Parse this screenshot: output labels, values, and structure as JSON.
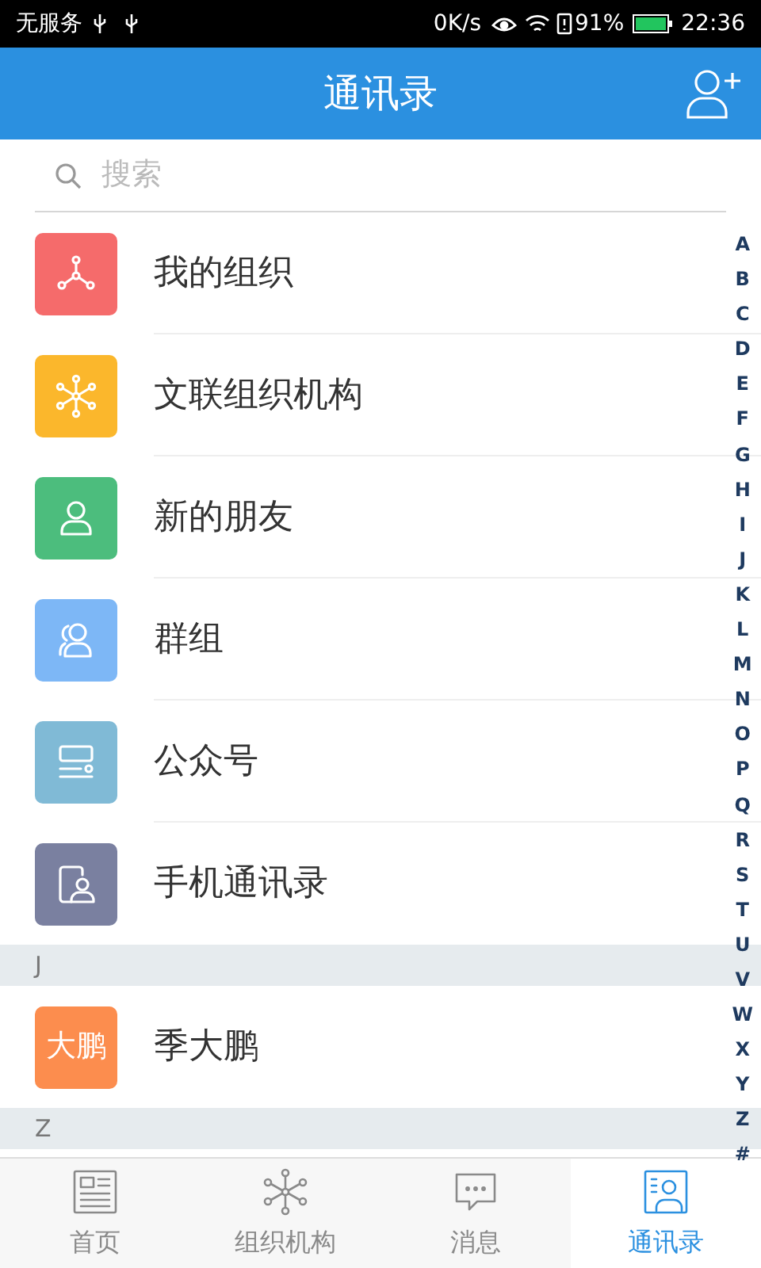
{
  "status_bar": {
    "carrier": "无服务",
    "speed": "0K/s",
    "battery": "91%",
    "time": "22:36"
  },
  "header": {
    "title": "通讯录"
  },
  "search": {
    "placeholder": "搜索"
  },
  "sections": [
    {
      "items": [
        {
          "kind": "icon",
          "label": "我的组织",
          "color": "#f56b6b"
        },
        {
          "kind": "icon",
          "label": "文联组织机构",
          "color": "#fbb72c"
        },
        {
          "kind": "icon",
          "label": "新的朋友",
          "color": "#4cbd7d"
        },
        {
          "kind": "icon",
          "label": "群组",
          "color": "#7db7f6"
        },
        {
          "kind": "icon",
          "label": "公众号",
          "color": "#80bad6"
        },
        {
          "kind": "icon",
          "label": "手机通讯录",
          "color": "#7a80a0"
        }
      ]
    },
    {
      "letter": "J",
      "items": [
        {
          "kind": "avatar",
          "avatar": "大鹏",
          "label": "季大鹏",
          "color": "#fc8d4e"
        }
      ]
    },
    {
      "letter": "Z"
    }
  ],
  "index": [
    "A",
    "B",
    "C",
    "D",
    "E",
    "F",
    "G",
    "H",
    "I",
    "J",
    "K",
    "L",
    "M",
    "N",
    "O",
    "P",
    "Q",
    "R",
    "S",
    "T",
    "U",
    "V",
    "W",
    "X",
    "Y",
    "Z",
    "#"
  ],
  "tabs": [
    {
      "label": "首页",
      "selected": false
    },
    {
      "label": "组织机构",
      "selected": false
    },
    {
      "label": "消息",
      "selected": false
    },
    {
      "label": "通讯录",
      "selected": true
    }
  ]
}
